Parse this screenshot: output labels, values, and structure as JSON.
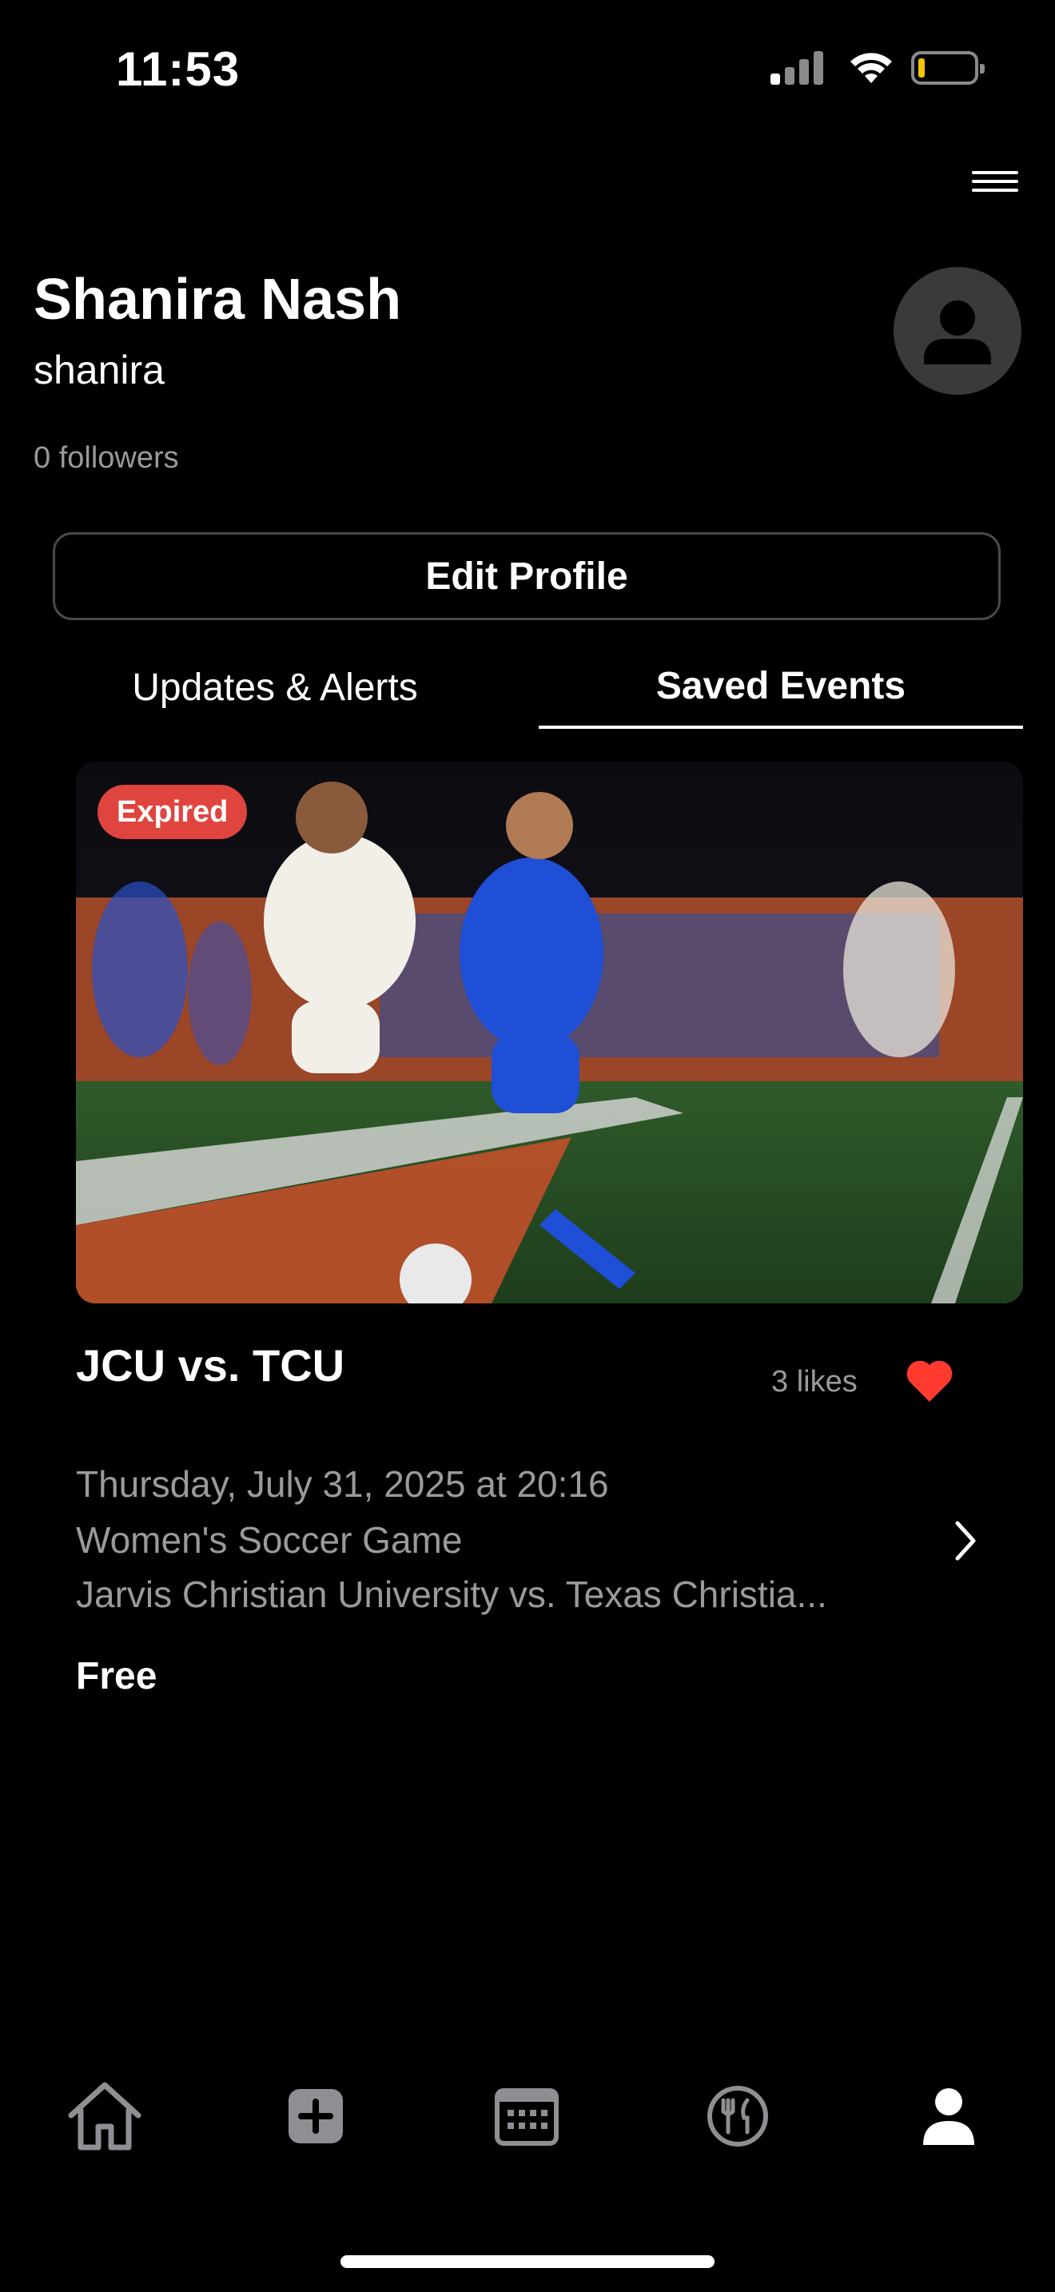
{
  "status_bar": {
    "time": "11:53"
  },
  "profile": {
    "name": "Shanira Nash",
    "username": "shanira",
    "followers": "0 followers",
    "edit_button": "Edit Profile"
  },
  "tabs": [
    {
      "label": "Updates & Alerts",
      "active": false
    },
    {
      "label": "Saved Events",
      "active": true
    }
  ],
  "event": {
    "badge": "Expired",
    "title": "JCU vs. TCU",
    "likes": "3 likes",
    "date": "Thursday, July 31, 2025 at 20:16",
    "category": "Women's Soccer Game",
    "teams": "Jarvis Christian University vs. Texas Christia...",
    "price": "Free",
    "liked": true
  },
  "bottom_nav": [
    {
      "icon": "home-icon",
      "active": false
    },
    {
      "icon": "add-icon",
      "active": false
    },
    {
      "icon": "calendar-icon",
      "active": false
    },
    {
      "icon": "dining-icon",
      "active": false
    },
    {
      "icon": "profile-icon",
      "active": true
    }
  ],
  "colors": {
    "background": "#000000",
    "badge_red": "#e0443e",
    "heart_red": "#ff3b30",
    "muted_text": "#9a9a9a"
  }
}
